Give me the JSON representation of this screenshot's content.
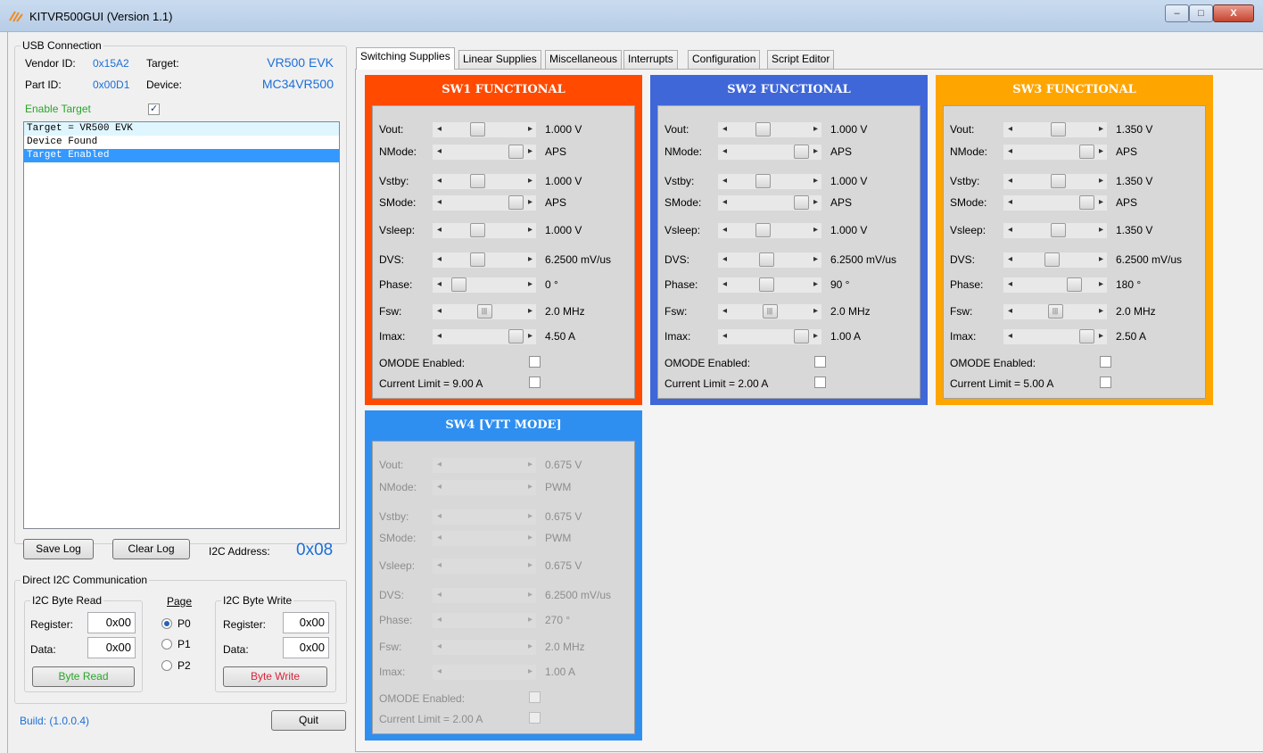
{
  "window": {
    "title": "KITVR500GUI (Version 1.1)",
    "min": "–",
    "max": "□",
    "close": "X"
  },
  "usb": {
    "legend": "USB Connection",
    "vendor_label": "Vendor ID:",
    "vendor_value": "0x15A2",
    "target_label": "Target:",
    "target_value": "VR500 EVK",
    "part_label": "Part ID:",
    "part_value": "0x00D1",
    "device_label": "Device:",
    "device_value": "MC34VR500",
    "enable_label": "Enable Target",
    "enable_checked": true
  },
  "log": {
    "lines": [
      "Target = VR500 EVK",
      "Device Found",
      "Target Enabled"
    ]
  },
  "buttons": {
    "save_log": "Save Log",
    "clear_log": "Clear Log",
    "quit": "Quit",
    "byte_read": "Byte Read",
    "byte_write": "Byte Write"
  },
  "i2c_address": {
    "label": "I2C Address:",
    "value": "0x08"
  },
  "direct_i2c": {
    "legend": "Direct I2C Communication",
    "read_legend": "I2C Byte Read",
    "read_register_label": "Register:",
    "read_register_value": "0x00",
    "read_data_label": "Data:",
    "read_data_value": "0x00",
    "page_label": "Page",
    "pages": [
      "P0",
      "P1",
      "P2"
    ],
    "selected_page": "P0",
    "write_legend": "I2C Byte Write",
    "write_register_label": "Register:",
    "write_register_value": "0x00",
    "write_data_label": "Data:",
    "write_data_value": "0x00"
  },
  "build": "Build: (1.0.0.4)",
  "tabs": [
    "Switching Supplies",
    "Linear Supplies",
    "Miscellaneous",
    "Interrupts",
    "Configuration",
    "Script Editor"
  ],
  "active_tab": "Switching Supplies",
  "row_labels": [
    "Vout:",
    "NMode:",
    "Vstby:",
    "SMode:",
    "Vsleep:",
    "DVS:",
    "Phase:",
    "Fsw:",
    "Imax:"
  ],
  "omode_label": "OMODE Enabled:",
  "panels": [
    {
      "title": "SW1 FUNCTIONAL",
      "color": "#ff4a00",
      "enabled": true,
      "values": [
        "1.000 V",
        "APS",
        "1.000 V",
        "APS",
        "1.000 V",
        "6.2500 mV/us",
        "0 °",
        "2.0 MHz",
        "4.50 A"
      ],
      "slider_levels": [
        0.4,
        1.0,
        0.4,
        1.0,
        0.4,
        0.4,
        0.1,
        0.5,
        1.0
      ],
      "current_limit": "Current Limit = 9.00 A"
    },
    {
      "title": "SW2 FUNCTIONAL",
      "color": "#3f67d8",
      "enabled": true,
      "values": [
        "1.000 V",
        "APS",
        "1.000 V",
        "APS",
        "1.000 V",
        "6.2500 mV/us",
        "90 °",
        "2.0 MHz",
        "1.00 A"
      ],
      "slider_levels": [
        0.4,
        1.0,
        0.4,
        1.0,
        0.4,
        0.45,
        0.45,
        0.5,
        1.0
      ],
      "current_limit": "Current Limit = 2.00 A"
    },
    {
      "title": "SW3 FUNCTIONAL",
      "color": "#ffa500",
      "enabled": true,
      "values": [
        "1.350 V",
        "APS",
        "1.350 V",
        "APS",
        "1.350 V",
        "6.2500 mV/us",
        "180 °",
        "2.0 MHz",
        "2.50 A"
      ],
      "slider_levels": [
        0.55,
        1.0,
        0.55,
        1.0,
        0.55,
        0.45,
        0.8,
        0.5,
        1.0
      ],
      "current_limit": "Current Limit = 5.00 A"
    },
    {
      "title": "SW4 [VTT MODE]",
      "color": "#2f8ff0",
      "enabled": false,
      "values": [
        "0.675 V",
        "PWM",
        "0.675 V",
        "PWM",
        "0.675 V",
        "6.2500 mV/us",
        "270 °",
        "2.0 MHz",
        "1.00 A"
      ],
      "current_limit": "Current Limit = 2.00 A"
    }
  ]
}
